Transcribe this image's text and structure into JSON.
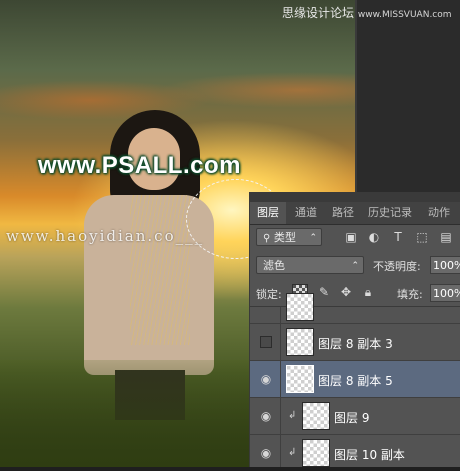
{
  "watermarks": {
    "site_cn": "思缘设计论坛",
    "site_en": "www.MISSVUAN.com",
    "psall": "www.PSALL.com",
    "hao": "www.haoyidian.co___"
  },
  "layers_panel": {
    "tabs": [
      "图层",
      "通道",
      "路径",
      "历史记录",
      "动作"
    ],
    "active_tab": "图层",
    "filter_kind": "类型",
    "blend_mode": "滤色",
    "opacity_label": "不透明度:",
    "opacity_value": "100%",
    "lock_label": "锁定:",
    "fill_label": "填充:",
    "fill_value": "100%",
    "layers": [
      {
        "name": "图层 8 副本 3",
        "visible": false,
        "selected": false,
        "clipped": false
      },
      {
        "name": "图层 8 副本 5",
        "visible": true,
        "selected": true,
        "clipped": false
      },
      {
        "name": "图层 9",
        "visible": true,
        "selected": false,
        "clipped": true
      },
      {
        "name": "图层 10 副本",
        "visible": true,
        "selected": false,
        "clipped": true
      }
    ]
  },
  "colors": {
    "panel_bg": "#535353",
    "selected_layer": "#5c6a80",
    "watermark_green": "#0c4a2a"
  }
}
